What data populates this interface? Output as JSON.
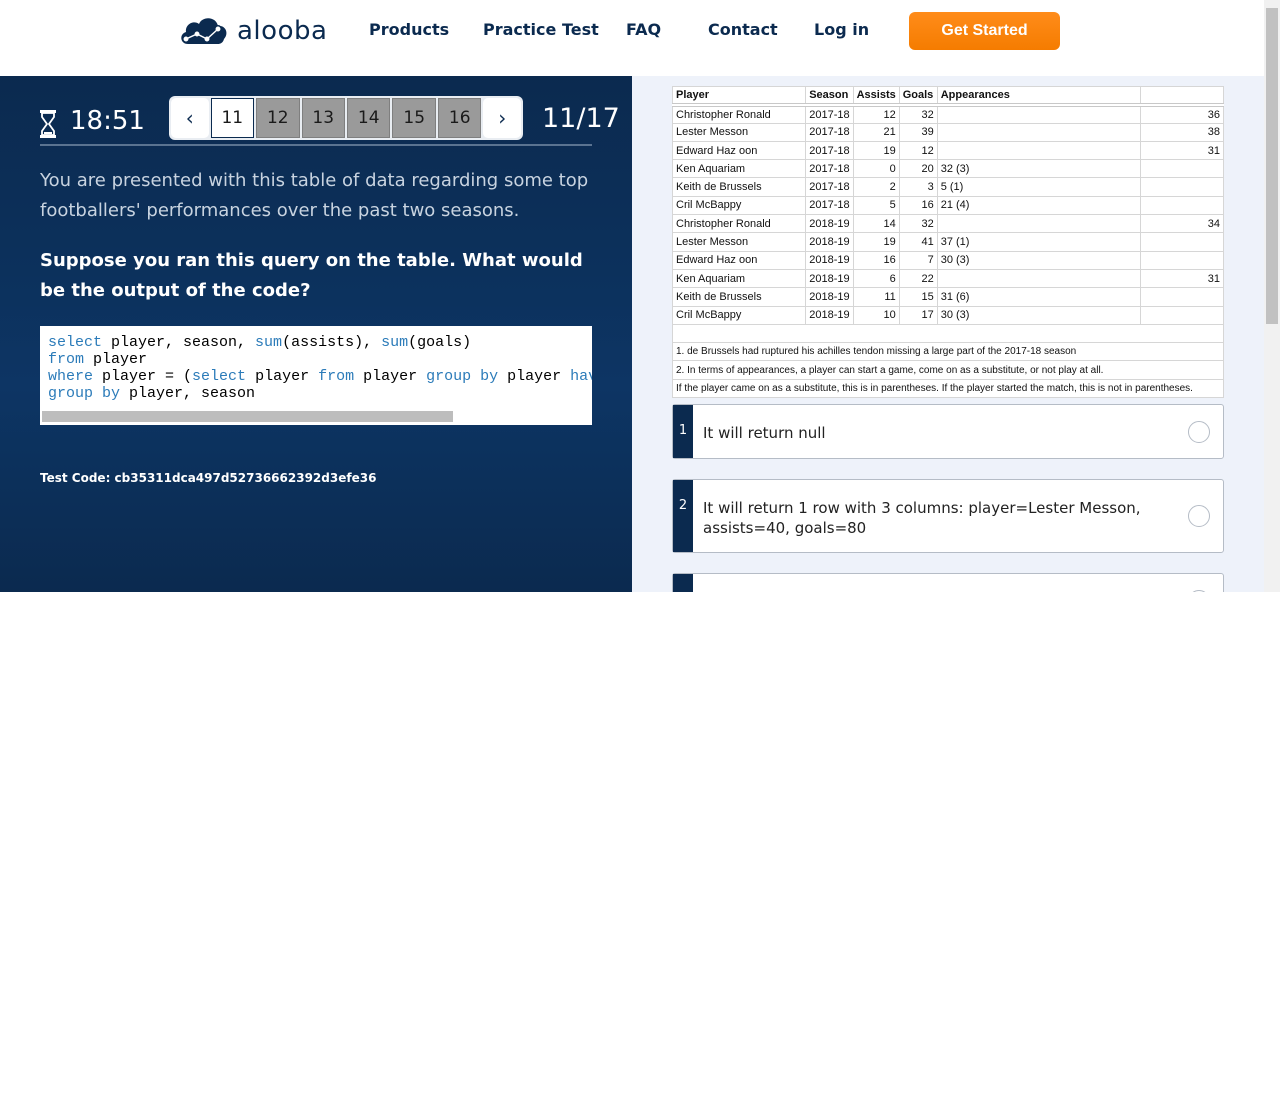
{
  "nav": {
    "logo_text": "alooba",
    "links": [
      "Products",
      "Practice Test",
      "FAQ",
      "Contact",
      "Log in"
    ],
    "cta": "Get Started"
  },
  "quiz": {
    "timer": "18:51",
    "pages": [
      "11",
      "12",
      "13",
      "14",
      "15",
      "16"
    ],
    "active_page": "11",
    "counter": "11/17",
    "intro": "You are presented with this table of data regarding some top footballers' performances over the past two seasons.",
    "question": "Suppose you ran this query on the table. What would be the output of the code?",
    "code_lines": [
      "select player, season, sum(assists), sum(goals)",
      "from player",
      "where player = (select player from player group by player hav",
      "group by player, season"
    ],
    "test_code": "Test Code: cb35311dca497d52736662392d3efe36"
  },
  "table": {
    "headers": [
      "Player",
      "Season",
      "Assists",
      "Goals",
      "Appearances",
      ""
    ],
    "rows": [
      [
        "Christopher Ronald",
        "2017-18",
        "12",
        "32",
        "",
        "36"
      ],
      [
        "Lester Messon",
        "2017-18",
        "21",
        "39",
        "",
        "38"
      ],
      [
        "Edward Haz oon",
        "2017-18",
        "19",
        "12",
        "",
        "31"
      ],
      [
        "Ken Aquariam",
        "2017-18",
        "0",
        "20",
        "32 (3)",
        ""
      ],
      [
        "Keith de Brussels",
        "2017-18",
        "2",
        "3",
        "5 (1)",
        ""
      ],
      [
        "Cril McBappy",
        "2017-18",
        "5",
        "16",
        "21 (4)",
        ""
      ],
      [
        "Christopher Ronald",
        "2018-19",
        "14",
        "32",
        "",
        "34"
      ],
      [
        "Lester Messon",
        "2018-19",
        "19",
        "41",
        "37 (1)",
        ""
      ],
      [
        "Edward Haz oon",
        "2018-19",
        "16",
        "7",
        "30 (3)",
        ""
      ],
      [
        "Ken Aquariam",
        "2018-19",
        "6",
        "22",
        "",
        "31"
      ],
      [
        "Keith de Brussels",
        "2018-19",
        "11",
        "15",
        "31 (6)",
        ""
      ],
      [
        "Cril McBappy",
        "2018-19",
        "10",
        "17",
        "30 (3)",
        ""
      ]
    ],
    "notes": [
      "1. de Brussels had ruptured his achilles tendon missing a large part of the 2017-18 season",
      "2. In terms of appearances, a player can start a game, come on as a substitute, or not play at all.",
      "If the player came on as a substitute, this is in parentheses. If the player started the match, this is not in parentheses."
    ]
  },
  "answers": [
    {
      "num": "1",
      "text": "It will return null"
    },
    {
      "num": "2",
      "text": "It will return 1 row with 3 columns: player=Lester Messon, assists=40, goals=80"
    },
    {
      "num": "",
      "text": ""
    }
  ]
}
